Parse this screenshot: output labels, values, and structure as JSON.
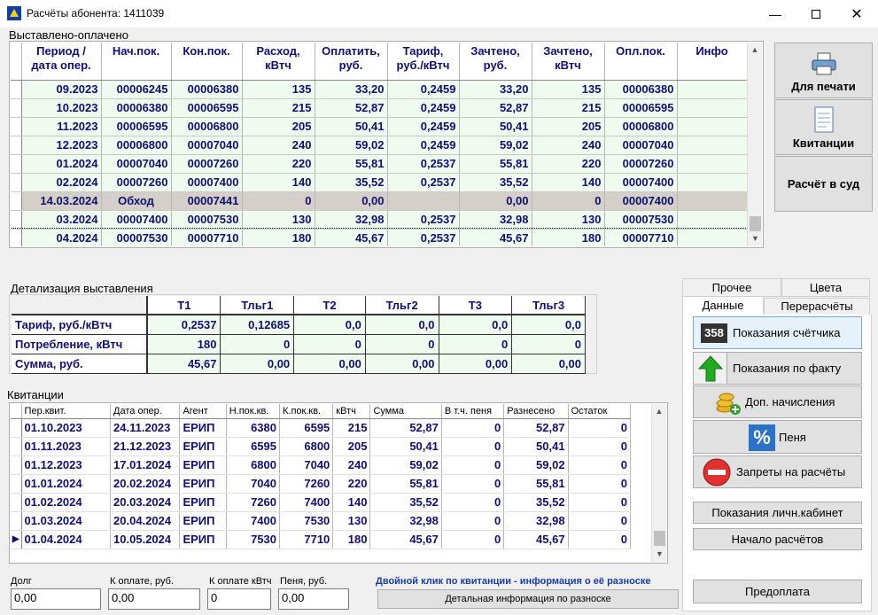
{
  "window": {
    "title": "Расчёты абонента: 1411039"
  },
  "billing": {
    "group_label": "Выставлено-оплачено",
    "headers": [
      "Период /\nдата опер.",
      "Нач.пок.",
      "Кон.пок.",
      "Расход,\nкВтч",
      "Оплатить,\nруб.",
      "Тариф,\nруб./кВтч",
      "Зачтено,\nруб.",
      "Зачтено,\nкВтч",
      "Опл.пок.",
      "Инфо"
    ],
    "rows": [
      [
        "09.2023",
        "00006245",
        "00006380",
        "135",
        "33,20",
        "0,2459",
        "33,20",
        "135",
        "00006380",
        ""
      ],
      [
        "10.2023",
        "00006380",
        "00006595",
        "215",
        "52,87",
        "0,2459",
        "52,87",
        "215",
        "00006595",
        ""
      ],
      [
        "11.2023",
        "00006595",
        "00006800",
        "205",
        "50,41",
        "0,2459",
        "50,41",
        "205",
        "00006800",
        ""
      ],
      [
        "12.2023",
        "00006800",
        "00007040",
        "240",
        "59,02",
        "0,2459",
        "59,02",
        "240",
        "00007040",
        ""
      ],
      [
        "01.2024",
        "00007040",
        "00007260",
        "220",
        "55,81",
        "0,2537",
        "55,81",
        "220",
        "00007260",
        ""
      ],
      [
        "02.2024",
        "00007260",
        "00007400",
        "140",
        "35,52",
        "0,2537",
        "35,52",
        "140",
        "00007400",
        ""
      ],
      [
        "14.03.2024",
        "Обход",
        "00007441",
        "0",
        "0,00",
        "",
        "0,00",
        "0",
        "00007400",
        ""
      ],
      [
        "03.2024",
        "00007400",
        "00007530",
        "130",
        "32,98",
        "0,2537",
        "32,98",
        "130",
        "00007530",
        ""
      ],
      [
        "04.2024",
        "00007530",
        "00007710",
        "180",
        "45,67",
        "0,2537",
        "45,67",
        "180",
        "00007710",
        ""
      ]
    ]
  },
  "side_buttons": {
    "print": "Для печати",
    "receipts": "Квитанции",
    "court": "Расчёт в суд"
  },
  "detail": {
    "group_label": "Детализация выставления",
    "headers": [
      "Т1",
      "Тльг1",
      "Т2",
      "Тльг2",
      "Т3",
      "Тльг3"
    ],
    "rows": [
      {
        "label": "Тариф, руб./кВтч",
        "values": [
          "0,2537",
          "0,12685",
          "0,0",
          "0,0",
          "0,0",
          "0,0"
        ]
      },
      {
        "label": "Потребление, кВтч",
        "values": [
          "180",
          "0",
          "0",
          "0",
          "0",
          "0"
        ]
      },
      {
        "label": "Сумма, руб.",
        "values": [
          "45,67",
          "0,00",
          "0,00",
          "0,00",
          "0,00",
          "0,00"
        ]
      }
    ]
  },
  "receipts": {
    "group_label": "Квитанции",
    "headers": [
      "Пер.квит.",
      "Дата опер.",
      "Агент",
      "Н.пок.кв.",
      "К.пок.кв.",
      "кВтч",
      "Сумма",
      "В т.ч. пеня",
      "Разнесено",
      "Остаток"
    ],
    "rows": [
      [
        "01.10.2023",
        "24.11.2023",
        "ЕРИП",
        "6380",
        "6595",
        "215",
        "52,87",
        "0",
        "52,87",
        "0"
      ],
      [
        "01.11.2023",
        "21.12.2023",
        "ЕРИП",
        "6595",
        "6800",
        "205",
        "50,41",
        "0",
        "50,41",
        "0"
      ],
      [
        "01.12.2023",
        "17.01.2024",
        "ЕРИП",
        "6800",
        "7040",
        "240",
        "59,02",
        "0",
        "59,02",
        "0"
      ],
      [
        "01.01.2024",
        "20.02.2024",
        "ЕРИП",
        "7040",
        "7260",
        "220",
        "55,81",
        "0",
        "55,81",
        "0"
      ],
      [
        "01.02.2024",
        "20.03.2024",
        "ЕРИП",
        "7260",
        "7400",
        "140",
        "35,52",
        "0",
        "35,52",
        "0"
      ],
      [
        "01.03.2024",
        "20.04.2024",
        "ЕРИП",
        "7400",
        "7530",
        "130",
        "32,98",
        "0",
        "32,98",
        "0"
      ],
      [
        "01.04.2024",
        "10.05.2024",
        "ЕРИП",
        "7530",
        "7710",
        "180",
        "45,67",
        "0",
        "45,67",
        "0"
      ]
    ]
  },
  "tabs": {
    "row1": [
      "Прочее",
      "Цвета"
    ],
    "row2": [
      "Данные",
      "Перерасчёты"
    ]
  },
  "actions": {
    "meter": "Показания счётчика",
    "meter_icon_text": "358",
    "fact": "Показания по факту",
    "extra": "Доп. начисления",
    "penalty": "Пеня",
    "bans": "Запреты на расчёты",
    "cabinet": "Показания личн.кабинет",
    "start": "Начало расчётов",
    "prepay": "Предоплата"
  },
  "footer": {
    "debt_label": "Долг",
    "debt_value": "0,00",
    "pay_rub_label": "К оплате, руб.",
    "pay_rub_value": "0,00",
    "pay_kwh_label": "К оплате кВтч",
    "pay_kwh_value": "0",
    "penalty_label": "Пеня, руб.",
    "penalty_value": "0,00",
    "hint": "Двойной клик по квитанции - информация о её разноске",
    "detail_button": "Детальная информация по разноске"
  }
}
